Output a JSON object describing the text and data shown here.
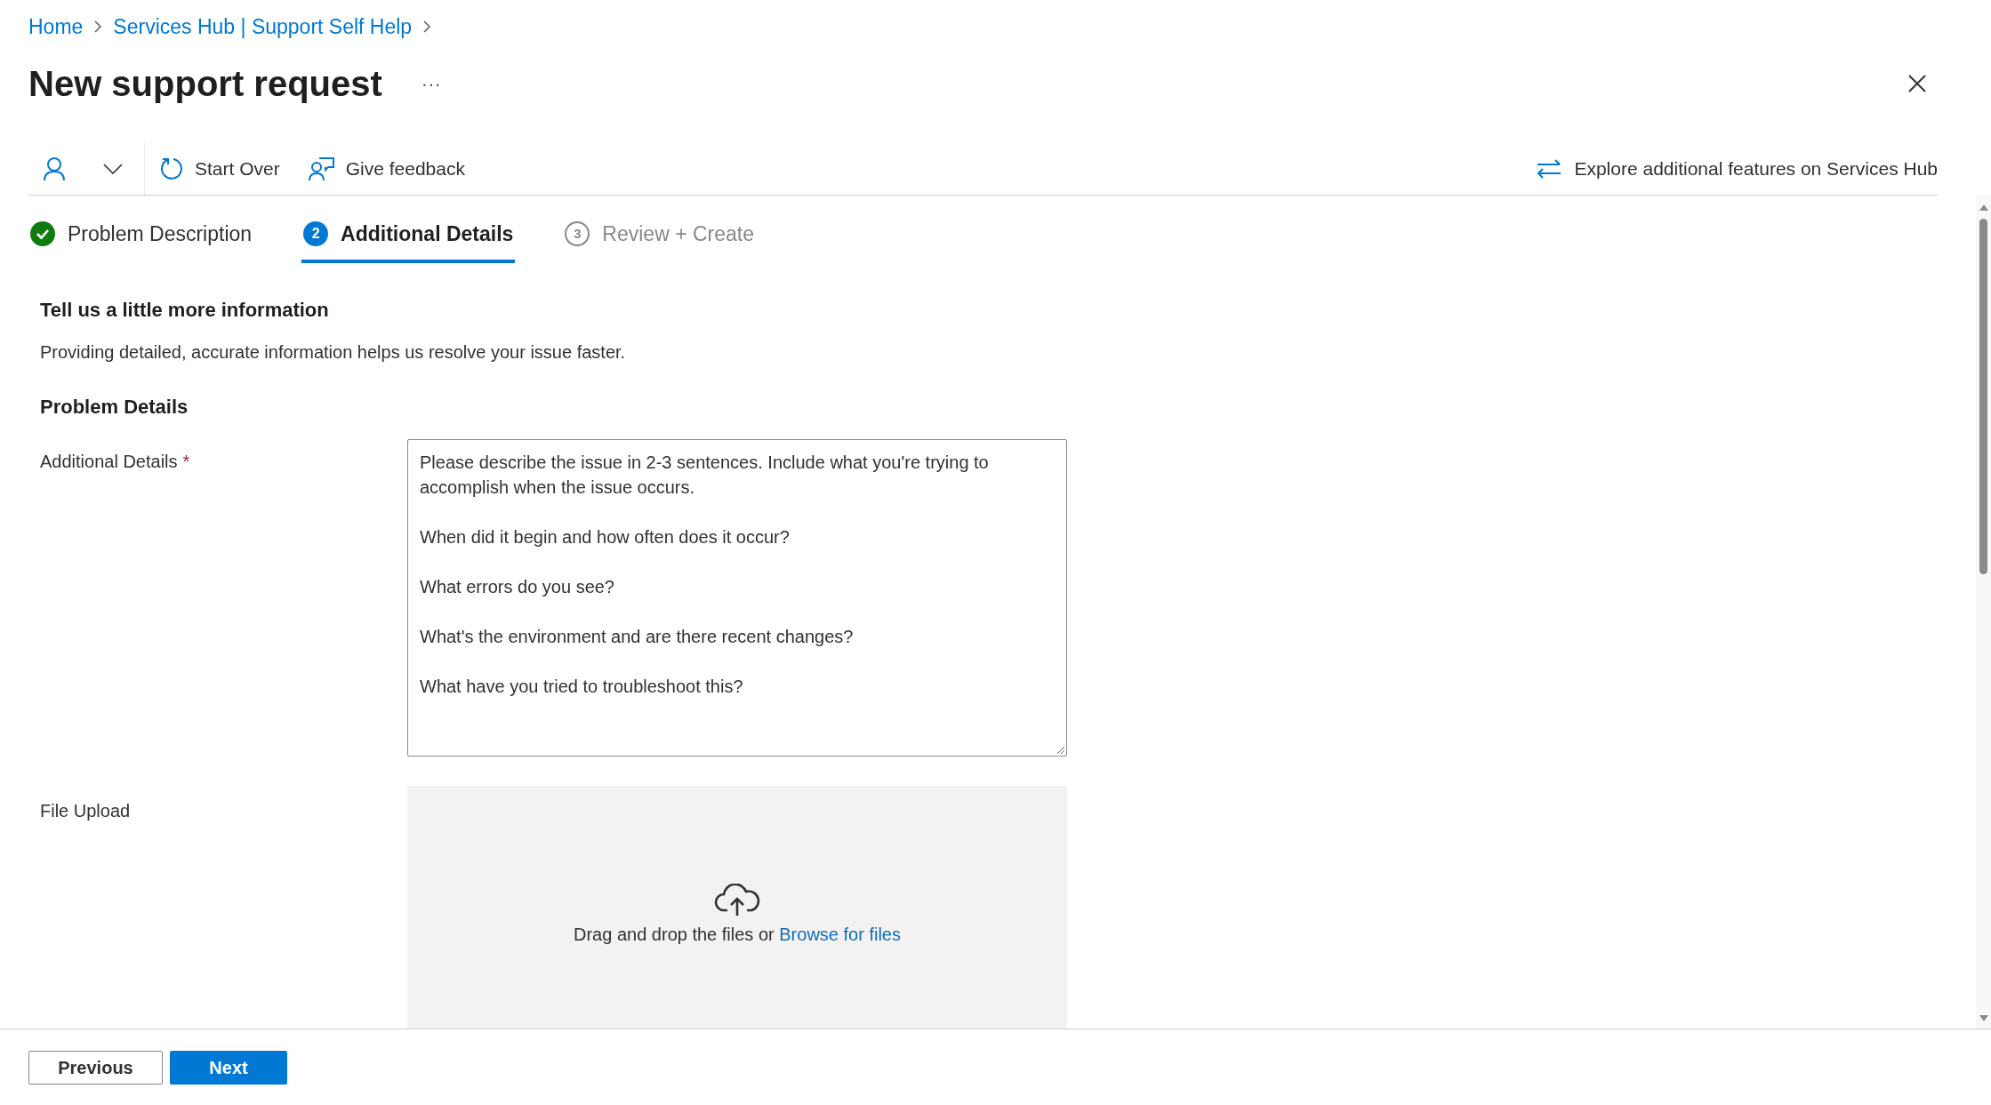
{
  "breadcrumb": [
    {
      "label": "Home"
    },
    {
      "label": "Services Hub | Support Self Help"
    }
  ],
  "title": "New support request",
  "more_button": "···",
  "toolbar": {
    "items": [
      {
        "kind": "user"
      },
      {
        "kind": "start_over",
        "label": "Start Over"
      },
      {
        "kind": "feedback",
        "label": "Give feedback"
      }
    ],
    "explore": "Explore additional features on Services Hub"
  },
  "steps": [
    {
      "label": "Problem Description",
      "completed": true,
      "selected": false
    },
    {
      "label": "Additional Details",
      "number": "2",
      "completed": false,
      "selected": true
    },
    {
      "label": "Review + Create",
      "number": "3",
      "completed": false,
      "selected": false
    }
  ],
  "section": {
    "heading": "Tell us a little more information",
    "description": "Providing detailed, accurate information helps us resolve your issue faster."
  },
  "problem_details": {
    "heading": "Problem Details",
    "additional_details": {
      "label": "Additional Details",
      "required_mark": "*",
      "placeholder": "Please describe the issue in 2-3 sentences. Include what you're trying to accomplish when the issue occurs.\n\nWhen did it begin and how often does it occur?\n\nWhat errors do you see?\n\nWhat's the environment and are there recent changes?\n\nWhat have you tried to troubleshoot this?"
    },
    "file_upload": {
      "label": "File Upload",
      "prompt": "Drag and drop the files or",
      "link": "Browse for files"
    }
  },
  "footer": {
    "buttons": [
      {
        "label": "Previous",
        "primary": false
      },
      {
        "label": "Next",
        "primary": true
      }
    ]
  }
}
